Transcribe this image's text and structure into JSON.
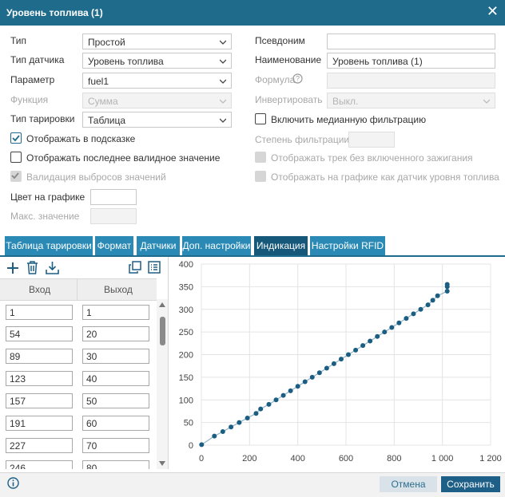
{
  "dialog": {
    "title": "Уровень топлива (1)"
  },
  "form": {
    "type": {
      "label": "Тип",
      "value": "Простой"
    },
    "sensor_type": {
      "label": "Тип датчика",
      "value": "Уровень топлива"
    },
    "parameter": {
      "label": "Параметр",
      "value": "fuel1"
    },
    "function": {
      "label": "Функция",
      "value": "Сумма"
    },
    "calibration_type": {
      "label": "Тип тарировки",
      "value": "Таблица"
    },
    "alias": {
      "label": "Псевдоним",
      "value": ""
    },
    "name": {
      "label": "Наименование",
      "value": "Уровень топлива (1)"
    },
    "formula": {
      "label": "Формула",
      "value": ""
    },
    "invert": {
      "label": "Инвертировать",
      "value": "Выкл."
    },
    "median_filter": {
      "label": "Включить медианную фильтрацию",
      "checked": false
    },
    "filter_degree": {
      "label": "Степень фильтрации",
      "value": ""
    },
    "show_in_tooltip": {
      "label": "Отображать в подсказке",
      "checked": true
    },
    "show_last_valid": {
      "label": "Отображать последнее валидное значение",
      "checked": false
    },
    "show_track_no_ignition": {
      "label": "Отображать трек без включенного зажигания",
      "checked": false
    },
    "validate_outliers": {
      "label": "Валидация выбросов значений",
      "checked": true
    },
    "show_as_fuel_sensor": {
      "label": "Отображать на графике как датчик уровня топлива",
      "checked": false
    },
    "graph_color": {
      "label": "Цвет на графике",
      "value": ""
    },
    "max_value": {
      "label": "Макс. значение",
      "value": ""
    }
  },
  "tabs": [
    {
      "label": "Таблица тарировки",
      "active": false
    },
    {
      "label": "Формат",
      "active": false
    },
    {
      "label": "Датчики",
      "active": false
    },
    {
      "label": "Доп. настройки",
      "active": false
    },
    {
      "label": "Индикация",
      "active": true
    },
    {
      "label": "Настройки RFID",
      "active": false
    }
  ],
  "table": {
    "headers": [
      "Вход",
      "Выход"
    ],
    "rows": [
      [
        "1",
        "1"
      ],
      [
        "54",
        "20"
      ],
      [
        "89",
        "30"
      ],
      [
        "123",
        "40"
      ],
      [
        "157",
        "50"
      ],
      [
        "191",
        "60"
      ],
      [
        "227",
        "70"
      ],
      [
        "246",
        "80"
      ]
    ]
  },
  "toolbar_icons": [
    "add-icon",
    "delete-icon",
    "import-icon",
    "copy-icon",
    "list-view-icon"
  ],
  "chart_data": {
    "type": "line",
    "x_ticks": [
      "0",
      "200",
      "400",
      "600",
      "800",
      "1 000",
      "1 200"
    ],
    "y_ticks": [
      "0",
      "50",
      "100",
      "150",
      "200",
      "250",
      "300",
      "350",
      "400"
    ],
    "xlim": [
      0,
      1200
    ],
    "ylim": [
      0,
      400
    ],
    "grid": true,
    "color": "#1b5e82",
    "series": [
      {
        "x": [
          1,
          54,
          89,
          123,
          157,
          191,
          227,
          246,
          280,
          310,
          340,
          370,
          400,
          430,
          460,
          490,
          520,
          550,
          580,
          610,
          640,
          670,
          700,
          730,
          760,
          790,
          820,
          850,
          880,
          910,
          940,
          960,
          980,
          1020,
          1020,
          1020
        ],
        "y": [
          1,
          20,
          30,
          40,
          50,
          60,
          70,
          80,
          90,
          100,
          110,
          120,
          130,
          140,
          150,
          160,
          170,
          180,
          190,
          200,
          210,
          220,
          230,
          240,
          250,
          260,
          270,
          280,
          290,
          300,
          310,
          320,
          330,
          340,
          350,
          355
        ]
      }
    ]
  },
  "footer": {
    "cancel_label": "Отмена",
    "save_label": "Сохранить"
  },
  "colors": {
    "header": "#1e6b8c",
    "tab": "#2a8ab5",
    "tab_active": "#16587a",
    "save": "#1d5f86",
    "cancel": "#d9e2e8"
  }
}
